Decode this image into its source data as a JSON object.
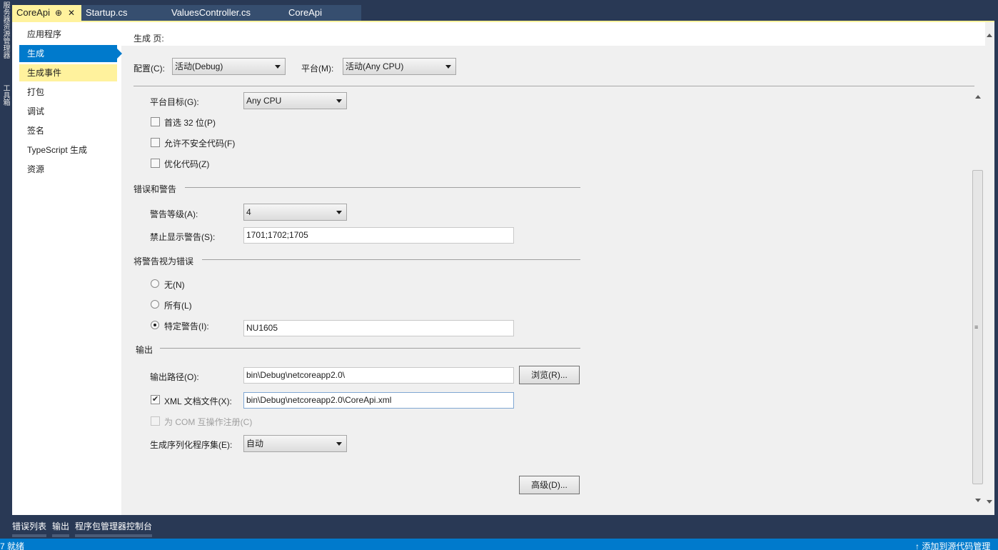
{
  "side_strip": {
    "label1": "服务器资源管理器",
    "label2": "工具箱"
  },
  "tabs": [
    {
      "label": "CoreApi",
      "pin": "⊕",
      "close": "✕"
    },
    {
      "label": "Startup.cs"
    },
    {
      "label": "ValuesController.cs"
    },
    {
      "label": "CoreApi"
    }
  ],
  "nav": {
    "items": [
      "应用程序",
      "生成",
      "生成事件",
      "打包",
      "调试",
      "签名",
      "TypeScript 生成",
      "资源"
    ]
  },
  "page": {
    "title": "生成 页:",
    "config_label": "配置(C):",
    "config_value": "活动(Debug)",
    "platform_label": "平台(M):",
    "platform_value": "活动(Any CPU)",
    "platform_target_label": "平台目标(G):",
    "platform_target_value": "Any CPU",
    "prefer32_label": "首选 32 位(P)",
    "unsafe_label": "允许不安全代码(F)",
    "optimize_label": "优化代码(Z)",
    "errors_section": "错误和警告",
    "warning_level_label": "警告等级(A):",
    "warning_level_value": "4",
    "suppress_label": "禁止显示警告(S):",
    "suppress_value": "1701;1702;1705",
    "treat_section": "将警告视为错误",
    "none_label": "无(N)",
    "all_label": "所有(L)",
    "specific_label": "特定警告(I):",
    "specific_value": "NU1605",
    "output_section": "输出",
    "output_path_label": "输出路径(O):",
    "output_path_value": "bin\\Debug\\netcoreapp2.0\\",
    "browse_button": "浏览(R)...",
    "xml_label": "XML 文档文件(X):",
    "xml_value": "bin\\Debug\\netcoreapp2.0\\CoreApi.xml",
    "com_label": "为 COM 互操作注册(C)",
    "serialization_label": "生成序列化程序集(E):",
    "serialization_value": "自动",
    "advanced_button": "高级(D)..."
  },
  "bottom_tabs": [
    "错误列表",
    "输出",
    "程序包管理器控制台"
  ],
  "status": {
    "left": "7 就绪",
    "right": "↑ 添加到源代码管理"
  },
  "colors": {
    "accent": "#007acc",
    "tab_active": "#fff29d",
    "chrome": "#293955"
  }
}
